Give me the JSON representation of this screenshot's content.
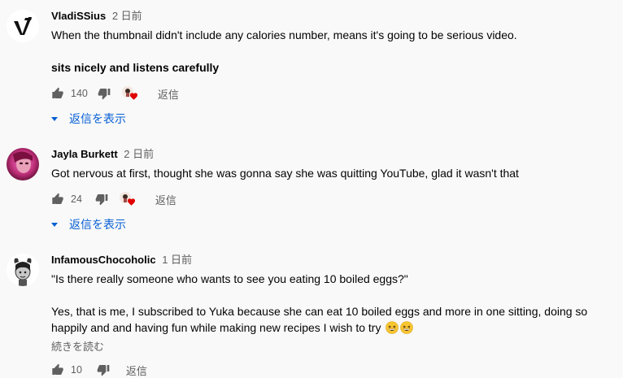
{
  "comments": [
    {
      "author": "VladiSSius",
      "time": "2 日前",
      "text": "When the thumbnail didn't include any calories number, means it's going to be serious video.",
      "text2": "sits nicely and listens carefully",
      "likes": "140",
      "reply_label": "返信",
      "replies_label": "返信を表示"
    },
    {
      "author": "Jayla Burkett",
      "time": "2 日前",
      "text": "Got nervous at first, thought she was gonna say she was quitting YouTube, glad it wasn't that",
      "likes": "24",
      "reply_label": "返信",
      "replies_label": "返信を表示"
    },
    {
      "author": "InfamousChocoholic",
      "time": "1 日前",
      "text": "\"Is there really someone who wants to see you eating 10 boiled eggs?\"",
      "text2": "Yes, that is me, I subscribed to Yuka because she can eat 10 boiled eggs and more in one sitting, doing so happily and and having fun while making new recipes I wish to try",
      "read_more": "続きを読む",
      "likes": "10",
      "reply_label": "返信"
    }
  ],
  "colors": {
    "accent": "#065fd4",
    "heart": "#e00000",
    "muted": "#606060"
  }
}
